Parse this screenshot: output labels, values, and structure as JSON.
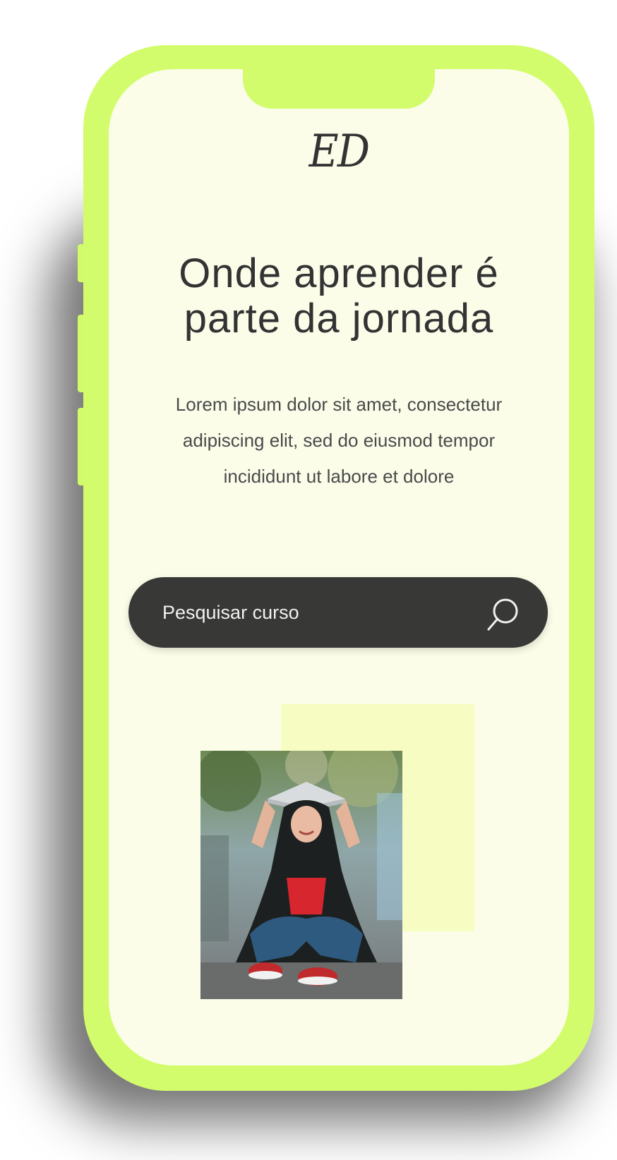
{
  "logo": "ED",
  "hero": {
    "headline_line1": "Onde aprender é",
    "headline_line2": "parte da jornada",
    "lede_line1": "Lorem ipsum dolor sit amet, consectetur",
    "lede_line2": "adipiscing elit, sed do eiusmod tempor",
    "lede_line3": "incididunt ut labore et dolore"
  },
  "search": {
    "placeholder": "Pesquisar curso",
    "icon": "search-icon"
  },
  "colors": {
    "frame": "#d3fc6c",
    "screen_bg": "#fbfde9",
    "search_bg": "#383836",
    "accent_block": "#f7fdc2",
    "text": "#333333"
  }
}
